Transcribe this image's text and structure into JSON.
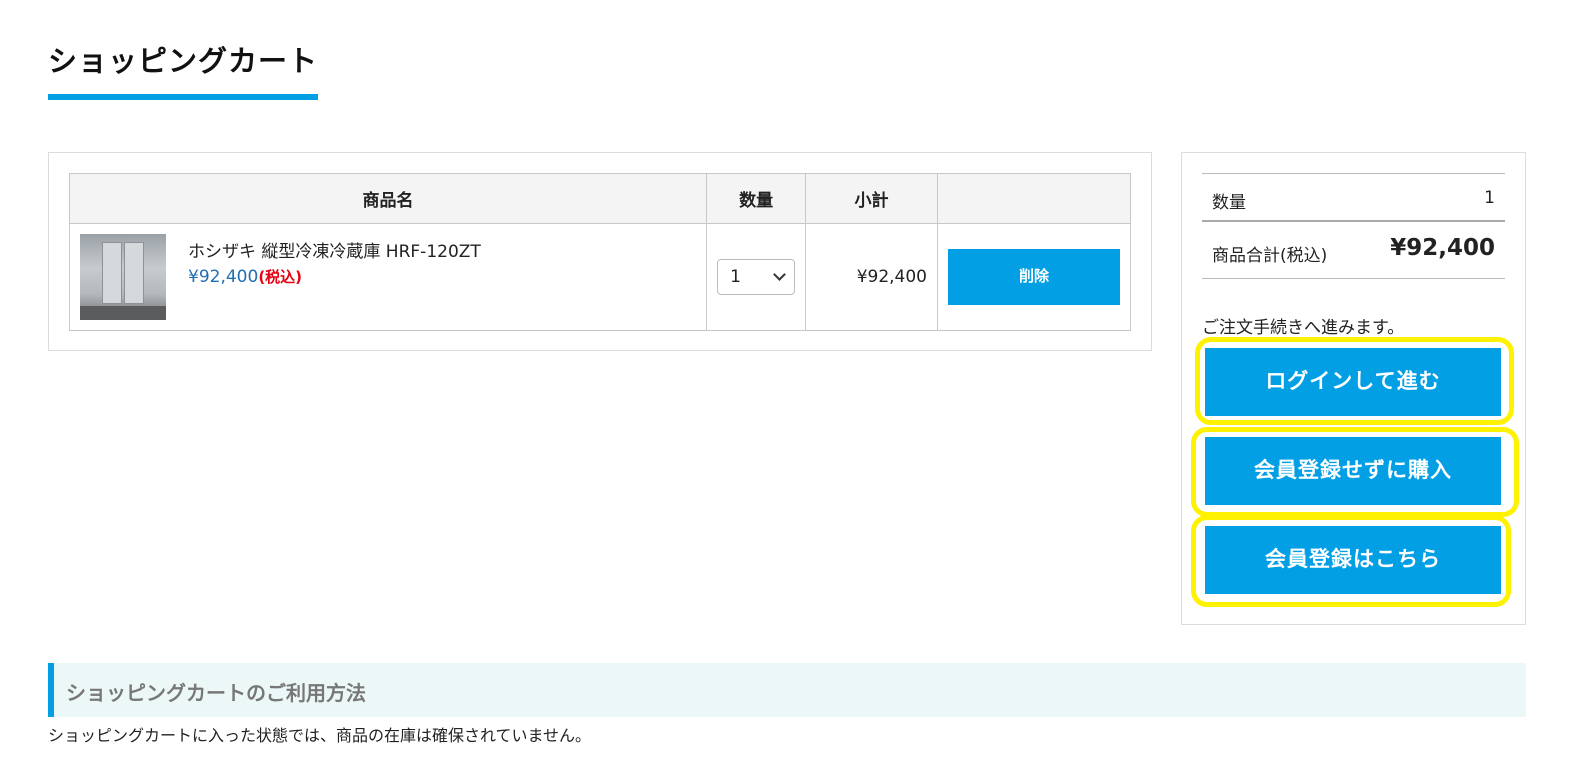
{
  "page": {
    "title": "ショッピングカート"
  },
  "cart": {
    "headers": {
      "name": "商品名",
      "qty": "数量",
      "subtotal": "小計",
      "action": ""
    },
    "items": [
      {
        "image_icon": "refrigerator-thumbnail",
        "name": "ホシザキ 縦型冷凍冷蔵庫 HRF-120ZT",
        "price": "¥92,400",
        "tax_label": "(税込)",
        "qty": "1",
        "subtotal": "¥92,400",
        "delete_label": "削除"
      }
    ]
  },
  "summary": {
    "qty_label": "数量",
    "qty_value": "1",
    "total_label": "商品合計(税込)",
    "total_value": "¥92,400",
    "note": "ご注文手続きへ進みます。",
    "buttons": {
      "login": "ログインして進む",
      "guest": "会員登録せずに購入",
      "register": "会員登録はこちら"
    }
  },
  "guide": {
    "title": "ショッピングカートのご利用方法",
    "text": "ショッピングカートに入った状態では、商品の在庫は確保されていません。"
  },
  "colors": {
    "accent": "#039fe5",
    "highlight": "#fff200",
    "tax": "#e60012",
    "price": "#1f6fb4"
  }
}
